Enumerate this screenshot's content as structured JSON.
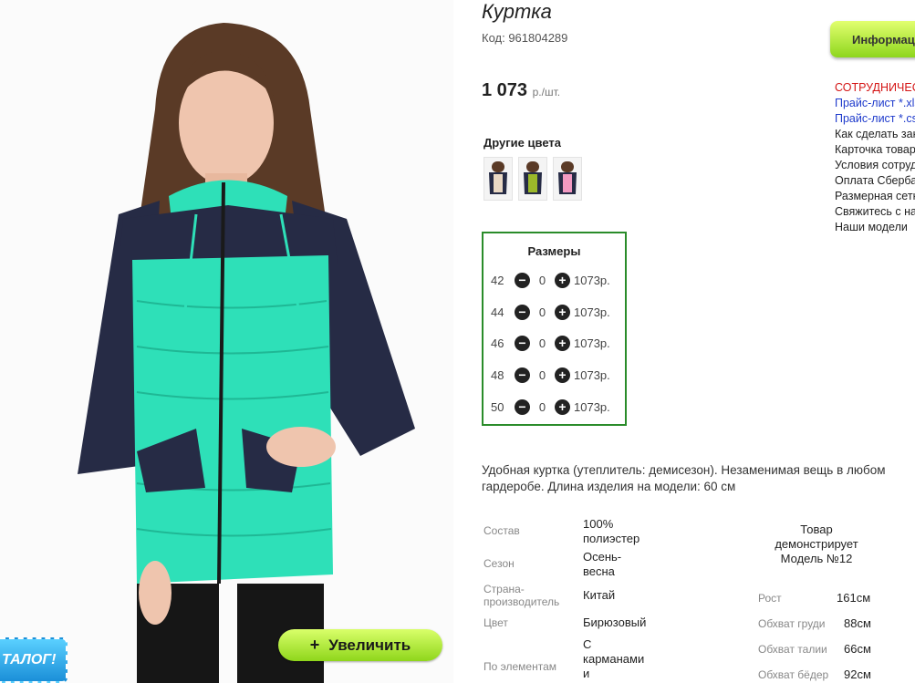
{
  "product": {
    "title": "Куртка",
    "code": "Код: 961804289",
    "price": "1 073",
    "price_unit": "р./шт.",
    "other_colors_heading": "Другие цвета",
    "other_colors": [
      {
        "name": "beige",
        "accent": "#e9d8c4"
      },
      {
        "name": "olive",
        "accent": "#9bb82a"
      },
      {
        "name": "pink",
        "accent": "#f29ac2"
      }
    ],
    "sizes_heading": "Размеры",
    "sizes": [
      {
        "size": "42",
        "qty": "0",
        "price": "1073р."
      },
      {
        "size": "44",
        "qty": "0",
        "price": "1073р."
      },
      {
        "size": "46",
        "qty": "0",
        "price": "1073р."
      },
      {
        "size": "48",
        "qty": "0",
        "price": "1073р."
      },
      {
        "size": "50",
        "qty": "0",
        "price": "1073р."
      }
    ],
    "description": "Удобная куртка (утеплитель: демисезон). Незаменимая вещь в любом гардеробе. Длина изделия на модели: 60 см",
    "specs": [
      {
        "label": "Состав",
        "value": "100% полиэстер"
      },
      {
        "label": "Сезон",
        "value": "Осень-весна"
      },
      {
        "label": "Страна-производитель",
        "value": "Китай"
      },
      {
        "label": "Цвет",
        "value": "Бирюзовый"
      },
      {
        "label": "По элементам",
        "value": "С карманами и"
      }
    ],
    "model_heading": "Товар демонстрирует Модель №12",
    "model_measures": [
      {
        "label": "Рост",
        "value": "161см"
      },
      {
        "label": "Обхват груди",
        "value": "88см"
      },
      {
        "label": "Обхват талии",
        "value": "66см"
      },
      {
        "label": "Обхват бёдер",
        "value": "92см"
      }
    ]
  },
  "image": {
    "zoom_label": "Увеличить",
    "zoom_icon": "plus-icon",
    "catalog_label": "ТАЛОГ!"
  },
  "info_panel": {
    "button_label": "Информация",
    "links": [
      {
        "text": "СОТРУДНИЧЕСТВО",
        "style": "red"
      },
      {
        "text": "Прайс-лист *.xls",
        "style": "blue"
      },
      {
        "text": "Прайс-лист *.csv",
        "style": "blue"
      },
      {
        "text": "Как сделать заказ",
        "style": "dark"
      },
      {
        "text": "Карточка товара",
        "style": "dark"
      },
      {
        "text": "Условия сотрудничества",
        "style": "dark"
      },
      {
        "text": "Оплата Сбербанк",
        "style": "dark"
      },
      {
        "text": "Размерная сетка",
        "style": "dark"
      },
      {
        "text": "Свяжитесь с нами",
        "style": "dark"
      },
      {
        "text": "Наши модели",
        "style": "dark"
      }
    ]
  },
  "colors": {
    "accent_green": "#8fd61b",
    "sizes_border": "#2a8c2a",
    "jacket_turquoise": "#2ee0b8",
    "jacket_navy": "#262b45",
    "link_red": "#d41414",
    "link_blue": "#1f3bcc"
  }
}
